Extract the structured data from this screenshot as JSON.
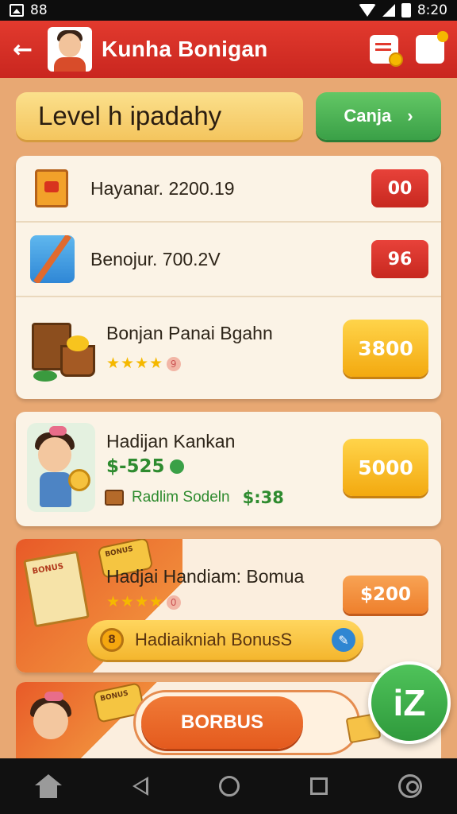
{
  "status_bar": {
    "left_text": "88",
    "time": "8:20"
  },
  "app_bar": {
    "title": "Kunha Bonigan"
  },
  "level": {
    "label": "Level h ipadahy",
    "button_label": "Canja",
    "button_arrow": "›"
  },
  "rows": [
    {
      "label": "Hayanar. 2200.19",
      "badge": "00"
    },
    {
      "label": "Benojur. 700.2V",
      "badge": "96"
    },
    {
      "label": "Bonjan Panai Bgahn",
      "stars": "★★★★",
      "rating": "9",
      "button": "3800"
    }
  ],
  "kid_card": {
    "name": "Hadijan Kankan",
    "price": "$-525",
    "sub_label": "Radlim Sodeln",
    "sub_value": "$:38",
    "button": "5000"
  },
  "bonus_card": {
    "title": "Hadjai Handiam: Bomua",
    "stars": "★★★★",
    "rating": "0",
    "button": "$200",
    "pill_label": "Hadiaikniah BonusS",
    "pill_coin": "8",
    "book_title": "BONUS",
    "tag_text": "BONUS"
  },
  "bottom_card": {
    "button": "BORBUS",
    "tag_text": "BONUS"
  },
  "fab": {
    "label": "iZ"
  },
  "colors": {
    "appbar": "#e23a2e",
    "accent_green": "#3aa047",
    "gold": "#f3a90f",
    "red_badge": "#c7281f"
  }
}
